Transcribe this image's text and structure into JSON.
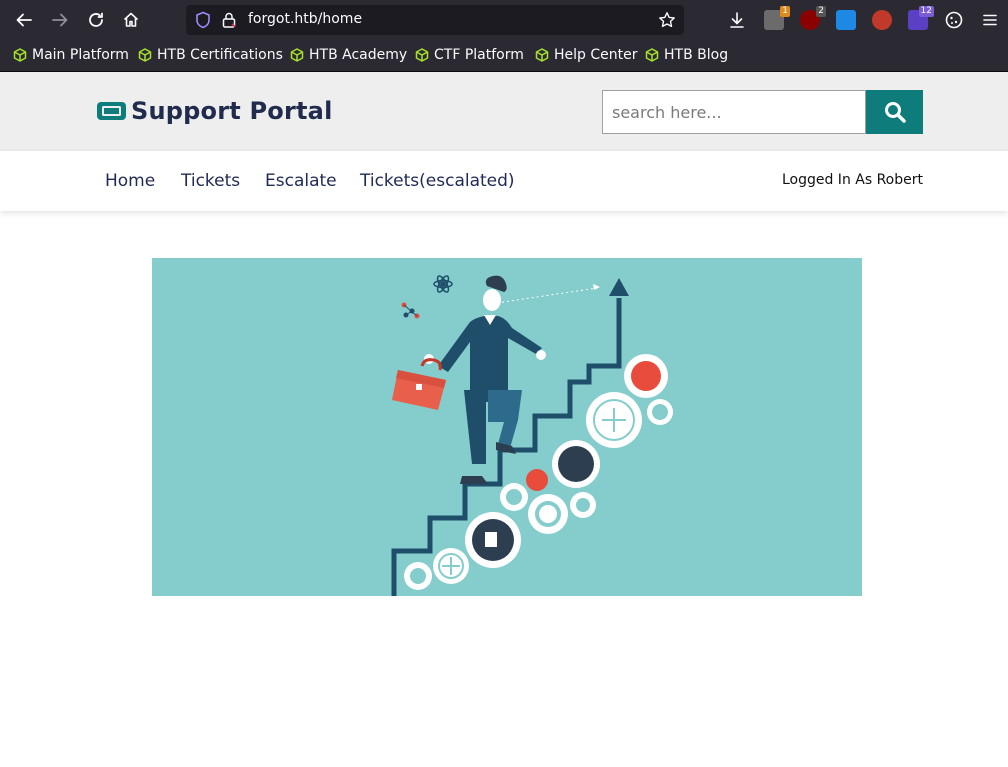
{
  "browser": {
    "url": "forgot.htb/home",
    "ext_badges": [
      "1",
      "2",
      "12"
    ],
    "bookmarks": [
      {
        "label": "Main Platform"
      },
      {
        "label": "HTB Certifications"
      },
      {
        "label": "HTB Academy"
      },
      {
        "label": "CTF Platform"
      },
      {
        "label": "Help Center"
      },
      {
        "label": "HTB Blog"
      }
    ]
  },
  "header": {
    "title": "Support Portal",
    "search_placeholder": "search here..."
  },
  "nav": {
    "items": [
      {
        "label": "Home"
      },
      {
        "label": "Tickets"
      },
      {
        "label": "Escalate"
      },
      {
        "label": "Tickets(escalated)"
      }
    ],
    "login_status": "Logged In As Robert"
  },
  "colors": {
    "accent": "#0f7c7c",
    "title": "#212b4e",
    "hero_bg": "#85cccc",
    "bookmark_icon": "#a6e22e"
  },
  "icons": {
    "back": "arrow-left-icon",
    "forward": "arrow-right-icon",
    "reload": "reload-icon",
    "home": "home-icon",
    "shield": "shield-icon",
    "lock": "lock-icon",
    "star": "star-icon",
    "download": "download-icon",
    "menu": "hamburger-menu-icon",
    "search": "search-icon",
    "logo": "ticket-icon"
  }
}
